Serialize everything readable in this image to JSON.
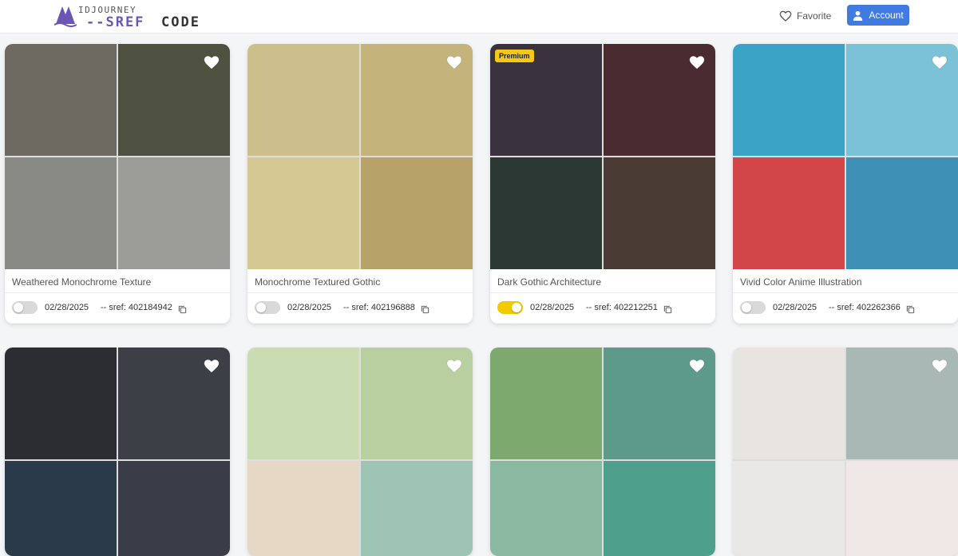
{
  "header": {
    "logo_top": "IDJOURNEY",
    "logo_sref": "--SREF",
    "logo_code": "CODE",
    "favorite_label": "Favorite",
    "account_label": "Account",
    "accent": "#3f7be0"
  },
  "cards": [
    {
      "title": "Weathered Monochrome Texture",
      "date": "02/28/2025",
      "sref": "-- sref: 402184942",
      "toggle_on": false,
      "premium": "",
      "colors": [
        "#6e6a62",
        "#4e5040",
        "#8a8a84",
        "#9c9c98"
      ]
    },
    {
      "title": "Monochrome Textured Gothic",
      "date": "02/28/2025",
      "sref": "-- sref: 402196888",
      "toggle_on": false,
      "premium": "",
      "colors": [
        "#cdbf8c",
        "#c4b47c",
        "#d6c892",
        "#b7a26a"
      ]
    },
    {
      "title": "Dark Gothic Architecture",
      "date": "02/28/2025",
      "sref": "-- sref: 402212251",
      "toggle_on": true,
      "premium": "Premium",
      "colors": [
        "#3b3240",
        "#4a2b30",
        "#2c3834",
        "#4a3b34"
      ]
    },
    {
      "title": "Vivid Color Anime Illustration",
      "date": "02/28/2025",
      "sref": "-- sref: 402262366",
      "toggle_on": false,
      "premium": "",
      "colors": [
        "#3aa3c6",
        "#7cc2d6",
        "#d2464a",
        "#3d8fb6"
      ]
    },
    {
      "title": "",
      "date": "",
      "sref": "",
      "toggle_on": false,
      "premium": "",
      "colors": [
        "#2b2d33",
        "#3c3f45",
        "#2a3a4a",
        "#3a3d48"
      ]
    },
    {
      "title": "",
      "date": "",
      "sref": "",
      "toggle_on": false,
      "premium": "",
      "colors": [
        "#c9dcb2",
        "#b8d0a0",
        "#e6d8c4",
        "#9ec4b6"
      ]
    },
    {
      "title": "",
      "date": "",
      "sref": "",
      "toggle_on": false,
      "premium": "",
      "colors": [
        "#7da86e",
        "#5e9a8a",
        "#8bb8a0",
        "#4ea08c"
      ]
    },
    {
      "title": "",
      "date": "",
      "sref": "",
      "toggle_on": false,
      "premium": "",
      "colors": [
        "#e8e4e0",
        "#a8b8b4",
        "#eae8e6",
        "#f0e8e6"
      ]
    }
  ]
}
